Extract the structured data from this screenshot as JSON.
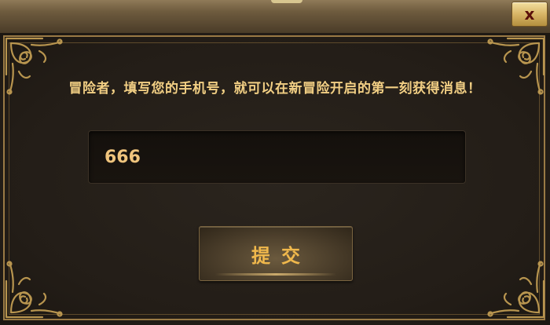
{
  "dialog": {
    "close_label": "x",
    "message": "冒险者，填写您的手机号，就可以在新冒险开启的第一刻获得消息！",
    "phone_input": {
      "value": "666",
      "placeholder": ""
    },
    "submit_label": "提交"
  },
  "colors": {
    "accent_gold": "#f2cf84",
    "frame_gold": "#9a7a45",
    "close_icon": "#5a0f0a",
    "background": "#2a241d"
  },
  "icons": {
    "close": "close-icon",
    "corner": "ornament-corner-icon"
  }
}
